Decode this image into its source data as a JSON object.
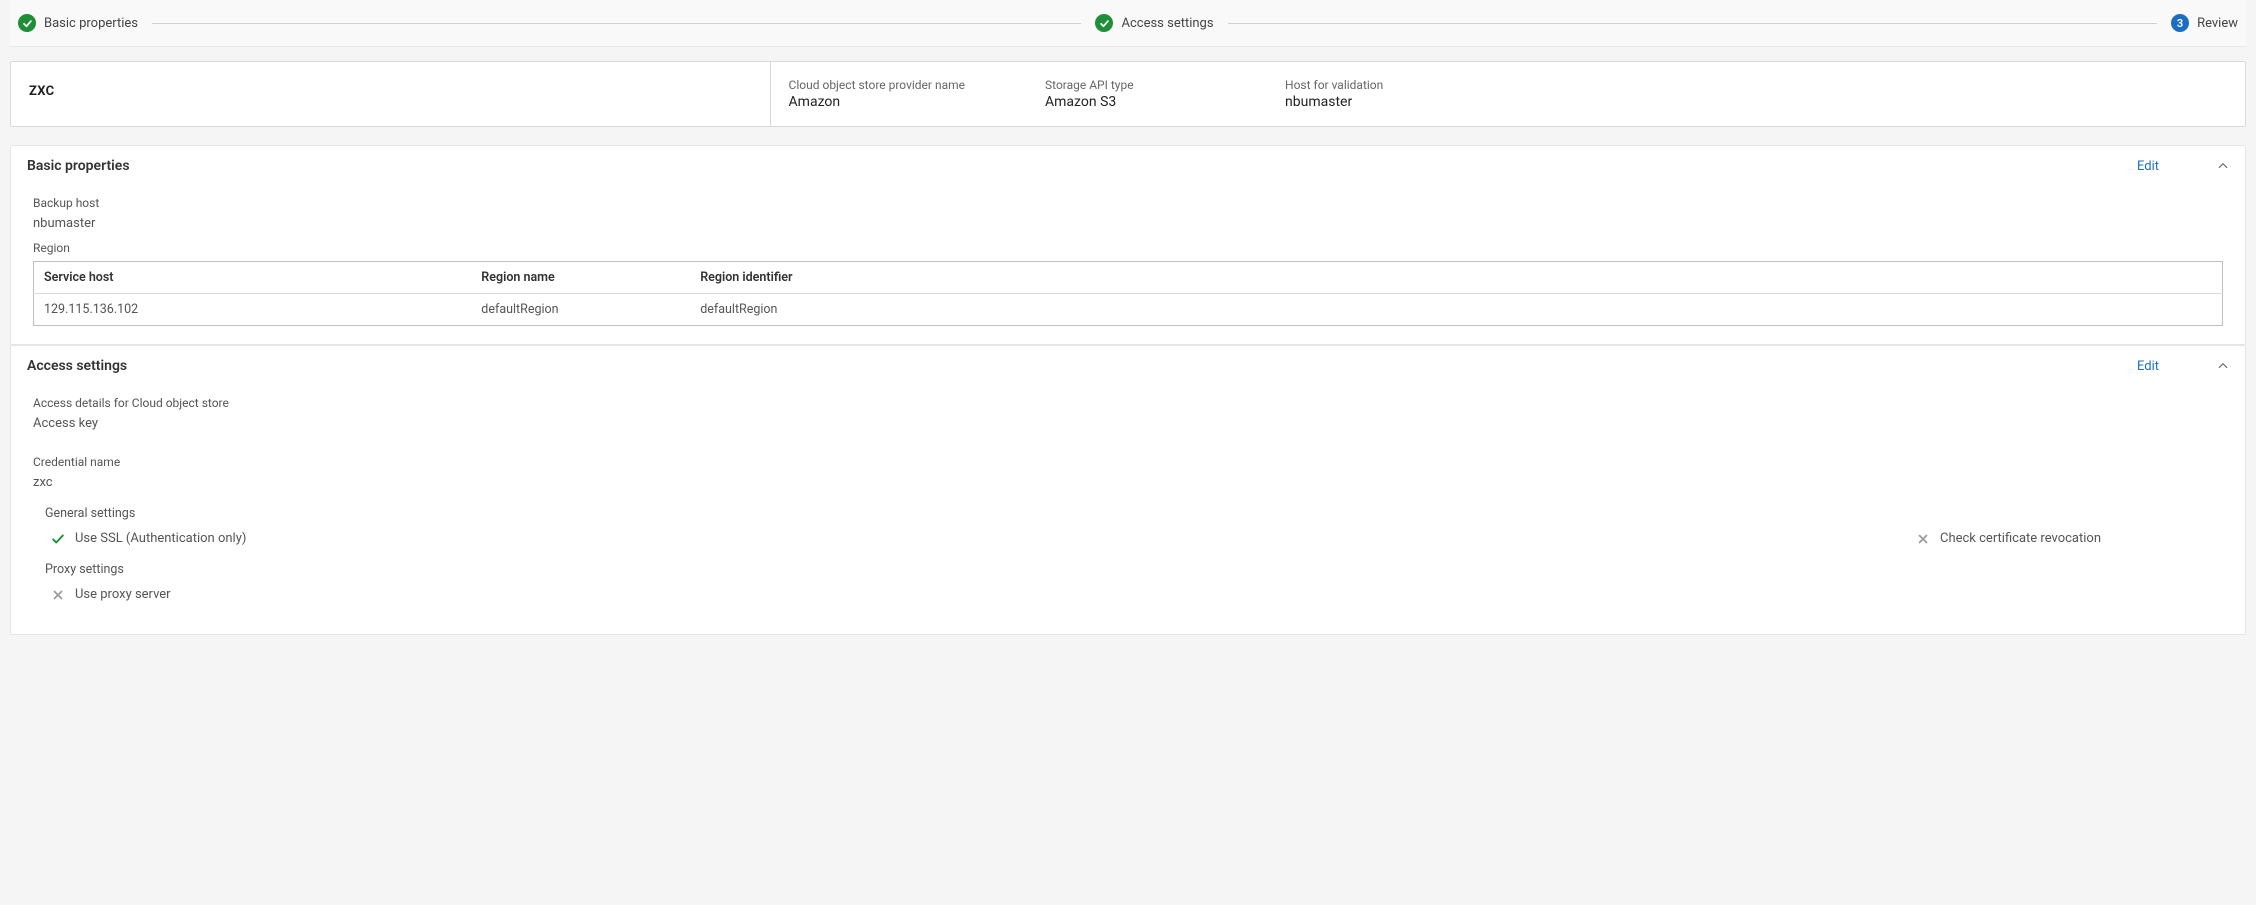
{
  "stepper": {
    "step1": {
      "label": "Basic properties",
      "state": "done"
    },
    "step2": {
      "label": "Access settings",
      "state": "done"
    },
    "step3": {
      "label": "Review",
      "number": "3",
      "state": "current"
    }
  },
  "summary": {
    "name": "ZXC",
    "cols": [
      {
        "label": "Cloud object store provider name",
        "value": "Amazon"
      },
      {
        "label": "Storage API type",
        "value": "Amazon S3"
      },
      {
        "label": "Host for validation",
        "value": "nbumaster"
      }
    ]
  },
  "basic_properties": {
    "title": "Basic properties",
    "edit": "Edit",
    "backup_host_label": "Backup host",
    "backup_host_value": "nbumaster",
    "region_label": "Region",
    "region_table": {
      "headers": {
        "service_host": "Service host",
        "region_name": "Region name",
        "region_identifier": "Region identifier"
      },
      "rows": [
        {
          "service_host": "129.115.136.102",
          "region_name": "defaultRegion",
          "region_identifier": "defaultRegion"
        }
      ]
    }
  },
  "access_settings": {
    "title": "Access settings",
    "edit": "Edit",
    "access_details_label": "Access details for Cloud object store",
    "access_key_label": "Access key",
    "credential_name_label": "Credential name",
    "credential_name_value": "zxc",
    "general_settings_label": "General settings",
    "use_ssl_label": "Use SSL (Authentication only)",
    "check_cert_label": "Check certificate revocation",
    "proxy_settings_label": "Proxy settings",
    "use_proxy_label": "Use proxy server"
  }
}
